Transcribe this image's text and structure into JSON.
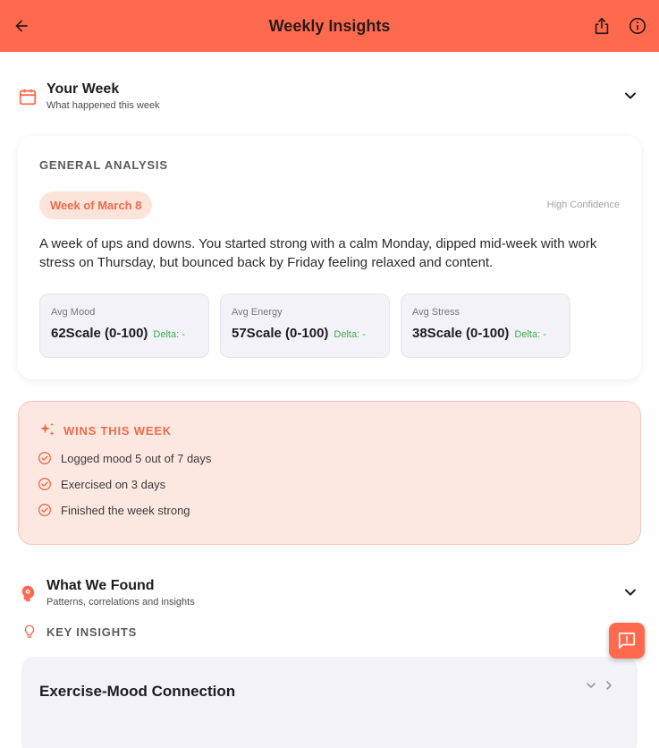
{
  "appbar": {
    "title": "Weekly Insights",
    "back_icon": "arrow-back-icon",
    "share_icon": "share-icon",
    "info_icon": "info-icon",
    "color": "#ff6a4f"
  },
  "your_week": {
    "title": "Your Week",
    "subtitle": "What happened this week",
    "icon": "calendar-icon"
  },
  "general_analysis": {
    "label": "GENERAL ANALYSIS",
    "week_label": "Week of March 8",
    "confidence": "High Confidence",
    "summary": "A week of ups and downs. You started strong with a calm Monday, dipped mid-week with work stress on Thursday, but bounced back by Friday feeling relaxed and content.",
    "stats": [
      {
        "name": "Avg Mood",
        "value": "62Scale (0-100)",
        "delta": "Delta: -"
      },
      {
        "name": "Avg Energy",
        "value": "57Scale (0-100)",
        "delta": "Delta: -"
      },
      {
        "name": "Avg Stress",
        "value": "38Scale (0-100)",
        "delta": "Delta: -"
      }
    ]
  },
  "wins": {
    "label": "WINS THIS WEEK",
    "icon": "sparkle-icon",
    "items": [
      "Logged mood 5 out of 7 days",
      "Exercised on 3 days",
      "Finished the week strong"
    ]
  },
  "what_we_found": {
    "title": "What We Found",
    "subtitle": "Patterns, correlations and insights",
    "icon": "brain-icon"
  },
  "key_insights": {
    "label": "KEY INSIGHTS",
    "icon": "lightbulb-icon",
    "cards": [
      {
        "title": "Exercise-Mood Connection"
      }
    ]
  },
  "fab": {
    "icon": "feedback-icon"
  },
  "colors": {
    "accent": "#ff6a4f",
    "accent_text": "#ef6a4a",
    "positive": "#3dae4f"
  }
}
